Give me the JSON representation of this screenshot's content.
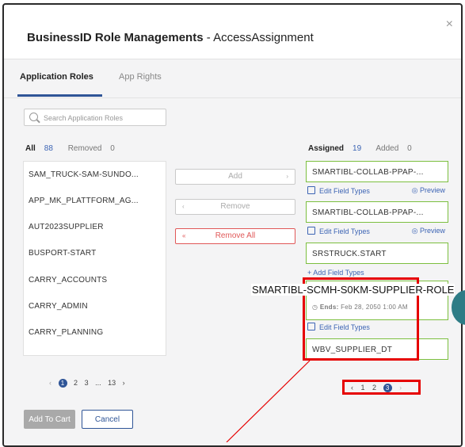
{
  "modal": {
    "title_bold": "BusinessID Role Managements",
    "title_rest": " - AccessAssignment",
    "close": "×"
  },
  "tabs": {
    "application_roles": "Application Roles",
    "app_rights": "App Rights"
  },
  "search": {
    "placeholder": "Search Application Roles"
  },
  "left_panel": {
    "all_label": "All",
    "all_count": "88",
    "removed_label": "Removed",
    "removed_count": "0",
    "items": [
      "SAM_TRUCK-SAM-SUNDO...",
      "APP_MK_PLATTFORM_AG...",
      "AUT2023SUPPLIER",
      "BUSPORT-START",
      "CARRY_ACCOUNTS",
      "CARRY_ADMIN",
      "CARRY_PLANNING"
    ]
  },
  "buttons": {
    "add": "Add",
    "remove": "Remove",
    "remove_all": "Remove All",
    "arrow_right": "›",
    "arrow_left": "‹",
    "double_left": "«"
  },
  "right_panel": {
    "assigned_label": "Assigned",
    "assigned_count": "19",
    "added_label": "Added",
    "added_count": "0",
    "cards": [
      "SMARTIBL-COLLAB-PPAP-...",
      "SMARTIBL-COLLAB-PPAP-...",
      "SRSTRUCK.START",
      "WBV_SUPPLIER_DT"
    ],
    "edit_field_types": "Edit Field Types",
    "add_field_types": "+ Add Field Types",
    "preview": "Preview",
    "ends_label": "Ends:",
    "ends_value": "Feb 28, 2050 1:00 AM",
    "tooltip": "SMARTIBL-SCMH-S0KM-SUPPLIER-ROLE"
  },
  "pager_left": {
    "prev": "‹",
    "p1": "1",
    "p2": "2",
    "p3": "3",
    "ellipsis": "...",
    "last": "13",
    "next": "›"
  },
  "pager_right": {
    "prev": "‹",
    "p1": "1",
    "p2": "2",
    "p3": "3",
    "next": "›"
  },
  "footer": {
    "add_to_cart": "Add To Cart",
    "cancel": "Cancel"
  },
  "colors": {
    "accent": "#2f5597",
    "highlight": "#e60000",
    "assigned_border": "#7cbf3f",
    "teal": "#2e7c86"
  }
}
